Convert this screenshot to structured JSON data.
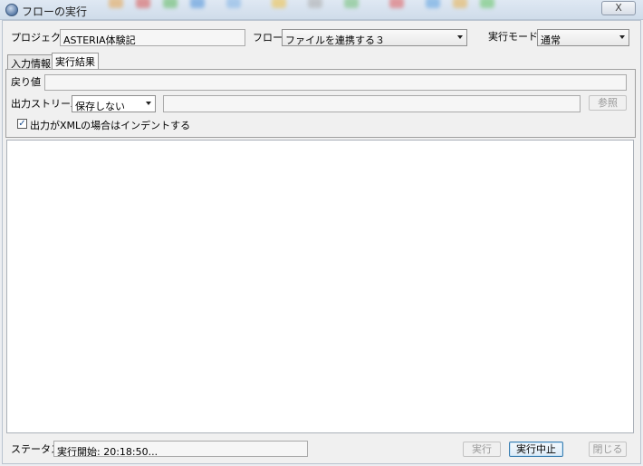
{
  "window": {
    "title": "フローの実行",
    "close_label": "X"
  },
  "form": {
    "project_label": "プロジェクト",
    "project_value": "ASTERIA体験記",
    "flow_label": "フロー",
    "flow_value": "ファイルを連携する３",
    "mode_label": "実行モード",
    "mode_value": "通常"
  },
  "tabs": [
    {
      "label": "入力情報",
      "selected": false
    },
    {
      "label": "実行結果",
      "selected": true
    }
  ],
  "result": {
    "return_label": "戻り値",
    "return_value": "",
    "stream_label": "出力ストリーム",
    "stream_option": "保存しない",
    "stream_path": "",
    "browse_label": "参照",
    "indent_checkbox_label": "出力がXMLの場合はインデントする",
    "indent_checked": true,
    "check_mark": "✓"
  },
  "footer": {
    "status_label": "ステータス",
    "status_value": "実行開始: 20:18:50...",
    "run_label": "実行",
    "stop_label": "実行中止",
    "close_label": "閉じる"
  }
}
